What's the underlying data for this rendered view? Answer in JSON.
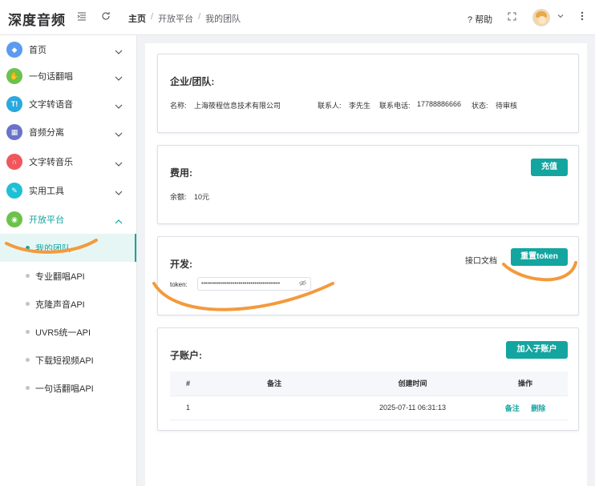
{
  "app": {
    "title": "深度音频"
  },
  "header": {
    "breadcrumb": [
      "主页",
      "开放平台",
      "我的团队"
    ],
    "separator": "/",
    "help_label": "帮助",
    "help_prefix": "?"
  },
  "sidebar": {
    "items": [
      {
        "label": "首页",
        "icon": "diamond-icon",
        "color": "#5b9bf0",
        "glyph": "◆"
      },
      {
        "label": "一句话翻唱",
        "icon": "thumb-icon",
        "color": "#6cc24a",
        "glyph": "✋"
      },
      {
        "label": "文字转语音",
        "icon": "text-icon",
        "color": "#2aa8e0",
        "glyph": "T!"
      },
      {
        "label": "音频分离",
        "icon": "grid-icon",
        "color": "#6a73c9",
        "glyph": "▦"
      },
      {
        "label": "文字转音乐",
        "icon": "headphone-icon",
        "color": "#f0575d",
        "glyph": "∩"
      },
      {
        "label": "实用工具",
        "icon": "wrench-icon",
        "color": "#1ec0d6",
        "glyph": "✎"
      },
      {
        "label": "开放平台",
        "icon": "open-platform-icon",
        "color": "#6cc24a",
        "glyph": "◉"
      }
    ],
    "sub_items": [
      "我的团队",
      "专业翻唱API",
      "克隆声音API",
      "UVR5统一API",
      "下载短视频API",
      "一句话翻唱API"
    ]
  },
  "company": {
    "title": "企业/团队:",
    "name_label": "名称:",
    "name_value": "上海筱程信息技术有限公司",
    "contact_label": "联系人:",
    "contact_value": "李先生",
    "phone_label": "联系电话:",
    "phone_value": "17788886666",
    "status_label": "状态:",
    "status_value": "待审核"
  },
  "fees": {
    "title": "费用:",
    "recharge_label": "充值",
    "balance_label": "余额:",
    "balance_value": "10元"
  },
  "dev": {
    "title": "开发:",
    "docs_label": "接口文档",
    "reset_label": "重置token",
    "token_label": "token:",
    "token_value": "••••••••••••••••••••••••••••••••••••••••"
  },
  "subaccounts": {
    "title": "子账户:",
    "add_label": "加入子账户",
    "columns": [
      "#",
      "备注",
      "创建时间",
      "操作"
    ],
    "rows": [
      {
        "index": "1",
        "note": "",
        "created": "2025-07-11 06:31:13",
        "action_note": "备注",
        "action_delete": "删除"
      }
    ]
  },
  "colors": {
    "accent": "#14a5a0",
    "annotation": "#f39a3c"
  }
}
